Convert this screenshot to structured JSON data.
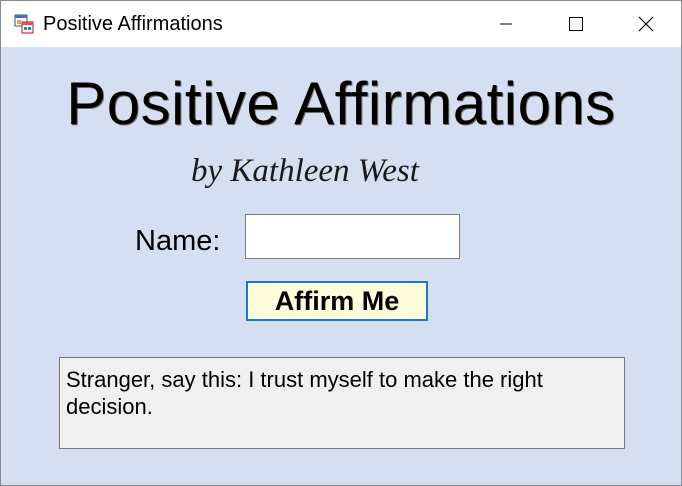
{
  "window": {
    "title": "Positive Affirmations",
    "icon": "winforms-app-icon",
    "controls": [
      "minimize-icon",
      "maximize-icon",
      "close-icon"
    ]
  },
  "form": {
    "heading": "Positive Affirmations",
    "byline": "by Kathleen West",
    "name_label": "Name:",
    "name_value": "",
    "affirm_button": "Affirm Me",
    "output_text": "Stranger, say this: I trust myself to make the right decision."
  },
  "colors": {
    "client_background": "#d4e0f1",
    "button_background": "#fdfcdb",
    "button_border": "#1f77d0",
    "output_background": "#f0f0f0"
  }
}
